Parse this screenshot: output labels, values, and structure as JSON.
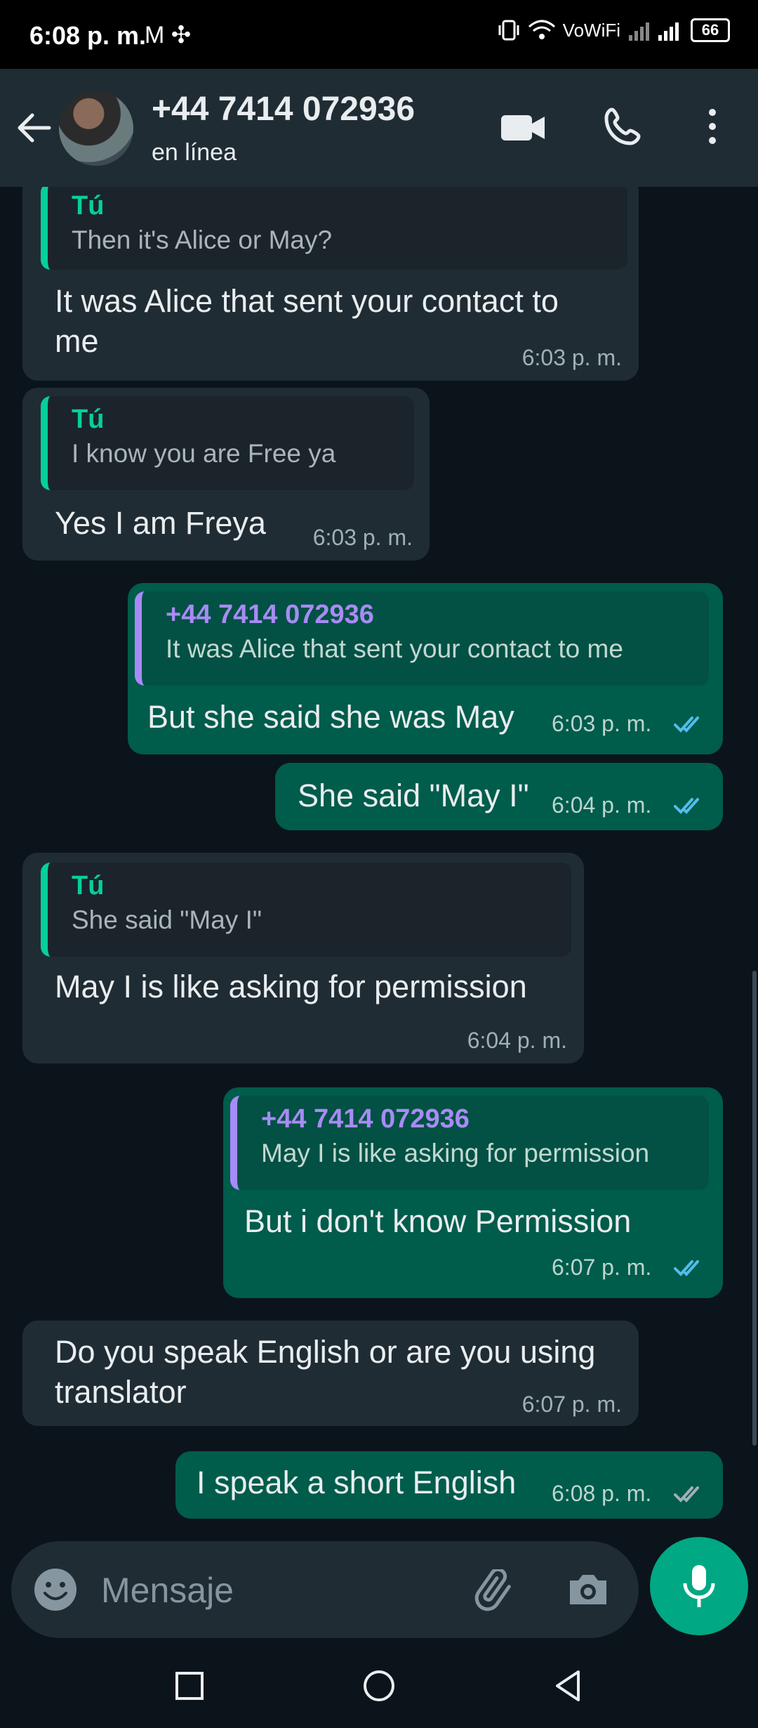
{
  "status_bar": {
    "time": "6:08 p. m.",
    "notif_icons": "M ✣",
    "vowifi": "VoWiFi",
    "battery": "66"
  },
  "header": {
    "contact_name": "+44 7414 072936",
    "status": "en línea"
  },
  "messages": [
    {
      "dir": "in",
      "quote_author": "Tú",
      "quote_text": "Then it's Alice or May?",
      "text_lines": [
        "It was Alice that sent your contact to",
        "me"
      ],
      "time": "6:03 p. m."
    },
    {
      "dir": "in",
      "quote_author": "Tú",
      "quote_text": "I know you are Free ya",
      "text_lines": [
        "Yes I am Freya"
      ],
      "time": "6:03 p. m."
    },
    {
      "dir": "out",
      "quote_author": "+44 7414 072936",
      "quote_text": "It was Alice that sent your contact to me",
      "text_lines": [
        "But she said she was May"
      ],
      "time": "6:03 p. m.",
      "ticks": "read"
    },
    {
      "dir": "out",
      "text_lines": [
        "She said \"May I\""
      ],
      "time": "6:04 p. m.",
      "ticks": "read"
    },
    {
      "dir": "in",
      "quote_author": "Tú",
      "quote_text": "She said \"May I\"",
      "text_lines": [
        "May I is like asking for permission"
      ],
      "time": "6:04 p. m."
    },
    {
      "dir": "out",
      "quote_author": "+44 7414 072936",
      "quote_text": "May I is like asking for permission",
      "text_lines": [
        "But i don't know Permission"
      ],
      "time": "6:07 p. m.",
      "ticks": "read"
    },
    {
      "dir": "in",
      "text_lines": [
        "Do you speak English or are you using",
        "translator"
      ],
      "time": "6:07 p. m."
    },
    {
      "dir": "out",
      "text_lines": [
        "I speak a short English"
      ],
      "time": "6:08 p. m.",
      "ticks": "delivered"
    }
  ],
  "input": {
    "placeholder": "Mensaje"
  },
  "colors": {
    "accent": "#00a884",
    "read_ticks": "#53bdeb",
    "delivered_ticks": "#9fb0b8",
    "incoming_bubble": "#202c33",
    "outgoing_bubble": "#005c4b"
  }
}
